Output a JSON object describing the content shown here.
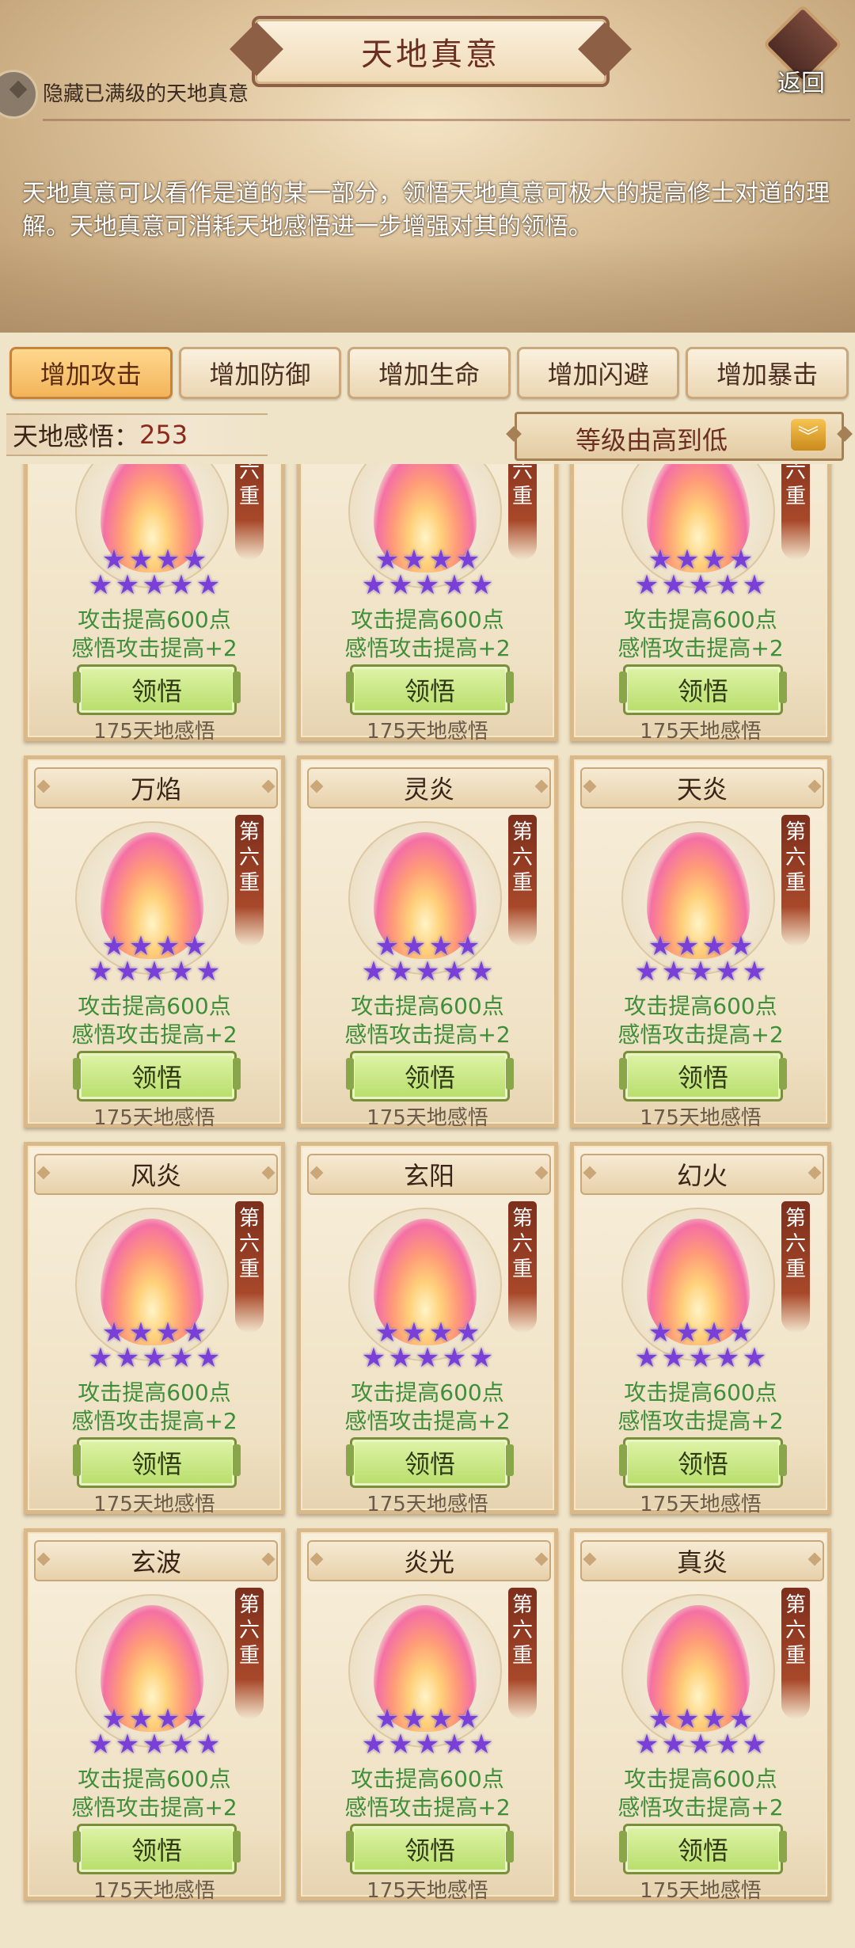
{
  "header": {
    "title": "天地真意",
    "back_label": "返回",
    "hide_maxed_label": "隐藏已满级的天地真意",
    "description": "天地真意可以看作是道的某一部分，领悟天地真意可极大的提高修士对道的理解。天地真意可消耗天地感悟进一步增强对其的领悟。"
  },
  "tabs": [
    {
      "label": "增加攻击",
      "active": true
    },
    {
      "label": "增加防御",
      "active": false
    },
    {
      "label": "增加生命",
      "active": false
    },
    {
      "label": "增加闪避",
      "active": false
    },
    {
      "label": "增加暴击",
      "active": false
    }
  ],
  "resource": {
    "label": "天地感悟：",
    "value": "253"
  },
  "sort": {
    "selected": "等级由高到低",
    "icon": "double-chevron-down-icon"
  },
  "colors": {
    "accent": "#f2b45a",
    "learn_button": "#b7de6a",
    "stat_text": "#3f8f3a",
    "star": "#7a3fd6",
    "rank_flag": "#7c2f1c"
  },
  "cards": [
    {
      "name": "",
      "rank": "第六重",
      "stars": 9,
      "stat1": "攻击提高600点",
      "stat2": "感悟攻击提高+2",
      "button": "领悟",
      "cost": "175天地感悟"
    },
    {
      "name": "",
      "rank": "第六重",
      "stars": 9,
      "stat1": "攻击提高600点",
      "stat2": "感悟攻击提高+2",
      "button": "领悟",
      "cost": "175天地感悟"
    },
    {
      "name": "",
      "rank": "第六重",
      "stars": 9,
      "stat1": "攻击提高600点",
      "stat2": "感悟攻击提高+2",
      "button": "领悟",
      "cost": "175天地感悟"
    },
    {
      "name": "万焰",
      "rank": "第六重",
      "stars": 9,
      "stat1": "攻击提高600点",
      "stat2": "感悟攻击提高+2",
      "button": "领悟",
      "cost": "175天地感悟"
    },
    {
      "name": "灵炎",
      "rank": "第六重",
      "stars": 9,
      "stat1": "攻击提高600点",
      "stat2": "感悟攻击提高+2",
      "button": "领悟",
      "cost": "175天地感悟"
    },
    {
      "name": "天炎",
      "rank": "第六重",
      "stars": 9,
      "stat1": "攻击提高600点",
      "stat2": "感悟攻击提高+2",
      "button": "领悟",
      "cost": "175天地感悟"
    },
    {
      "name": "风炎",
      "rank": "第六重",
      "stars": 9,
      "stat1": "攻击提高600点",
      "stat2": "感悟攻击提高+2",
      "button": "领悟",
      "cost": "175天地感悟"
    },
    {
      "name": "玄阳",
      "rank": "第六重",
      "stars": 9,
      "stat1": "攻击提高600点",
      "stat2": "感悟攻击提高+2",
      "button": "领悟",
      "cost": "175天地感悟"
    },
    {
      "name": "幻火",
      "rank": "第六重",
      "stars": 9,
      "stat1": "攻击提高600点",
      "stat2": "感悟攻击提高+2",
      "button": "领悟",
      "cost": "175天地感悟"
    },
    {
      "name": "玄波",
      "rank": "第六重",
      "stars": 9,
      "stat1": "攻击提高600点",
      "stat2": "感悟攻击提高+2",
      "button": "领悟",
      "cost": "175天地感悟"
    },
    {
      "name": "炎光",
      "rank": "第六重",
      "stars": 9,
      "stat1": "攻击提高600点",
      "stat2": "感悟攻击提高+2",
      "button": "领悟",
      "cost": "175天地感悟"
    },
    {
      "name": "真炎",
      "rank": "第六重",
      "stars": 9,
      "stat1": "攻击提高600点",
      "stat2": "感悟攻击提高+2",
      "button": "领悟",
      "cost": "175天地感悟"
    }
  ]
}
